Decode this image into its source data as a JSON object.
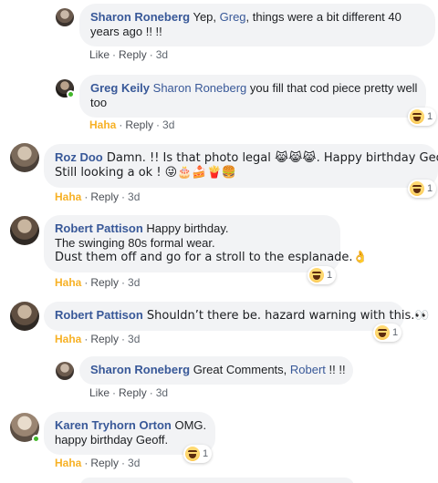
{
  "comments": [
    {
      "author": "Sharon Roneberg",
      "segments": [
        {
          "t": "Yep, ",
          "k": "text"
        },
        {
          "t": "Greg",
          "k": "mention"
        },
        {
          "t": ", things were a bit different 40",
          "k": "text"
        }
      ],
      "line2": "years ago !! !!",
      "actions": {
        "like": "Like",
        "reply": "Reply",
        "time": "3d"
      }
    },
    {
      "author": "Greg Keily",
      "mention": "Sharon Roneberg",
      "text1": " you fill that cod piece pretty well",
      "line2": "too",
      "actions": {
        "like": "Haha",
        "reply": "Reply",
        "time": "3d"
      },
      "reaction": {
        "icon": "haha-icon",
        "count": "1"
      }
    },
    {
      "author": "Roz Doo",
      "text1": " Damn. !! Is that photo legal 😹😹😹. Happy birthday Geoff .",
      "line2": "Still looking a ok ! 😜🎂🍰🍟🍔",
      "actions": {
        "like": "Haha",
        "reply": "Reply",
        "time": "3d"
      },
      "reaction": {
        "icon": "haha-icon",
        "count": "1"
      }
    },
    {
      "author": "Robert Pattison",
      "text1": " Happy birthday.",
      "line2": "The swinging 80s formal wear.",
      "line3": "Dust them off and go for a stroll to the esplanade.👌",
      "actions": {
        "like": "Haha",
        "reply": "Reply",
        "time": "3d"
      },
      "reaction": {
        "icon": "haha-icon",
        "count": "1"
      }
    },
    {
      "author": "Robert Pattison",
      "text1": " Shouldn’t there be. hazard warning with this.👀",
      "actions": {
        "like": "Haha",
        "reply": "Reply",
        "time": "3d"
      },
      "reaction": {
        "icon": "haha-icon",
        "count": "1"
      }
    },
    {
      "author": "Sharon Roneberg",
      "text1": " Great Comments, ",
      "mention": "Robert",
      "text2": " !! !!",
      "actions": {
        "like": "Like",
        "reply": "Reply",
        "time": "3d"
      }
    },
    {
      "author": "Karen Tryhorn Orton",
      "text1": " OMG.",
      "line2": "happy birthday Geoff.",
      "actions": {
        "like": "Haha",
        "reply": "Reply",
        "time": "3d"
      },
      "reaction": {
        "icon": "haha-icon",
        "count": "1"
      }
    }
  ],
  "separator": "·",
  "colors": {
    "link": "#385898",
    "haha": "#f7b125",
    "bubble": "#f2f3f5",
    "online": "#42b72a"
  }
}
